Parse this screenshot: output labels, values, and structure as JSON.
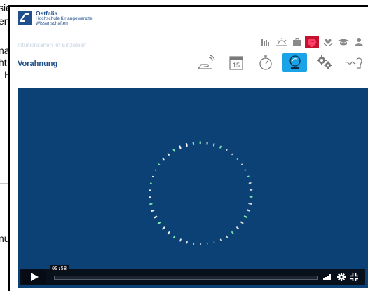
{
  "background": {
    "fragments": [
      "sie",
      "en",
      "na",
      "ht",
      "H",
      "nu"
    ]
  },
  "header": {
    "logo_name": "Ostfalia",
    "logo_sub": "Hochschule für angewandte Wissenschaften"
  },
  "section_label": "Intuitionsarten im Einzelnen",
  "page_title": "Vorahnung",
  "top_icons": [
    {
      "name": "chart-icon"
    },
    {
      "name": "sunrise-icon"
    },
    {
      "name": "briefcase-icon"
    },
    {
      "name": "brain-icon",
      "active": true
    },
    {
      "name": "heart-hands-icon"
    },
    {
      "name": "graduation-cap-icon"
    },
    {
      "name": "person-icon"
    }
  ],
  "big_icons": [
    {
      "name": "hand-signal-icon"
    },
    {
      "name": "calendar-icon",
      "label": "15"
    },
    {
      "name": "stopwatch-icon"
    },
    {
      "name": "crystal-ball-icon",
      "active": true
    },
    {
      "name": "gears-icon"
    },
    {
      "name": "wave-brain-icon"
    },
    {
      "name": "phone-signal-icon"
    }
  ],
  "player": {
    "time": "00:58",
    "progress": 0.0,
    "accent_color": "#2d93e0"
  }
}
